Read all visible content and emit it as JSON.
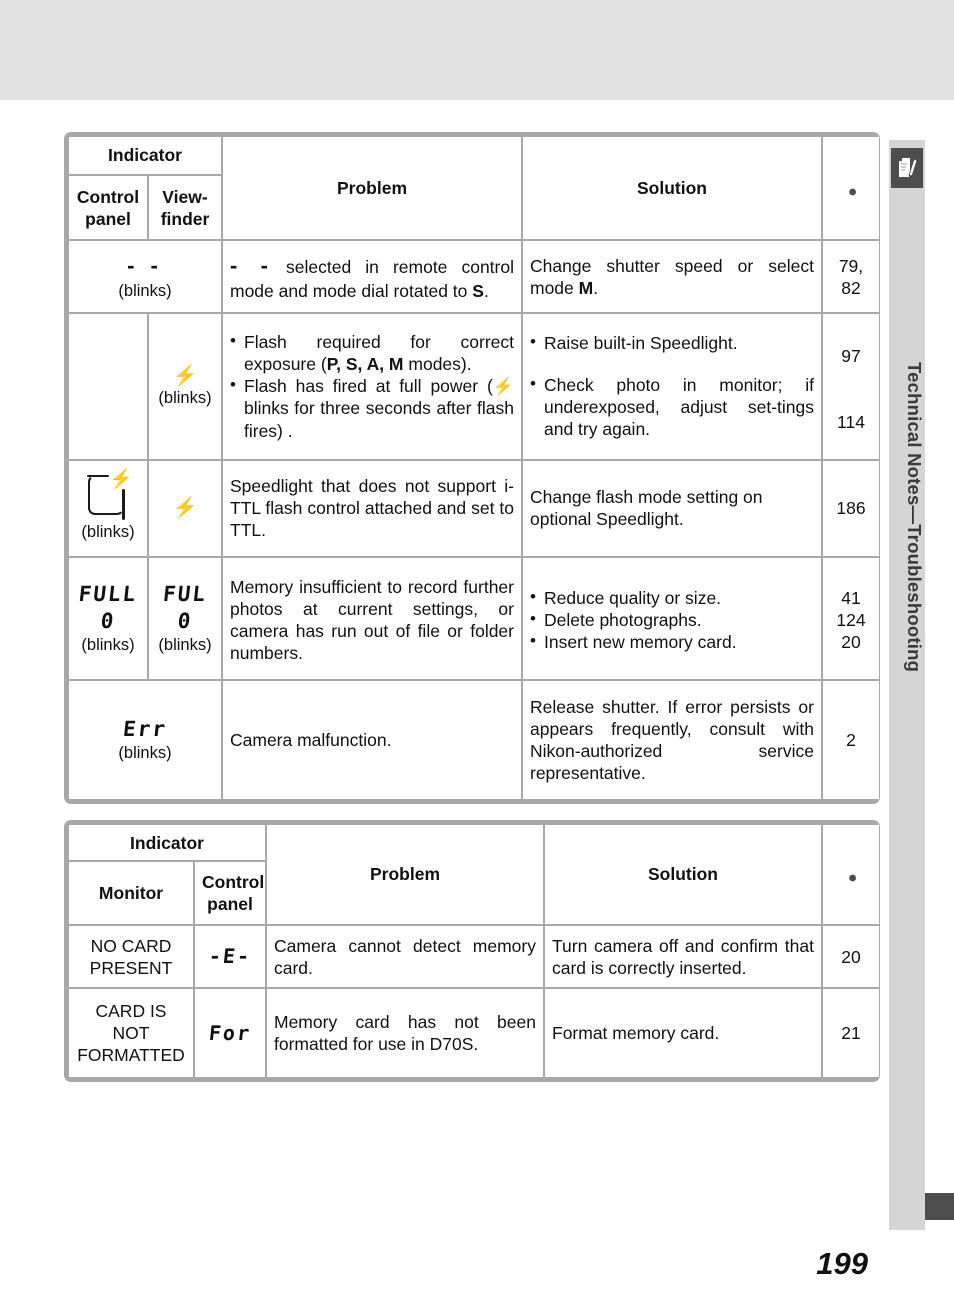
{
  "sidebar": {
    "icon": "pencil-note-icon",
    "label": "Technical Notes—Troubleshooting"
  },
  "page_number": "199",
  "colors": {
    "header_bg": "#4d4d4d",
    "table_border": "#a8a8a8",
    "shade_row": "#e9e9e9",
    "top_band": "#e2e2e2",
    "side_tab": "#d5d5d5"
  },
  "table1": {
    "headers": {
      "indicator": "Indicator",
      "control_panel": "Control\npanel",
      "control_panel_l1": "Control",
      "control_panel_l2": "panel",
      "viewfinder_l1": "View-",
      "viewfinder_l2": "finder",
      "problem": "Problem",
      "solution": "Solution",
      "page_ref_icon": "eye-reference-icon"
    },
    "rows": [
      {
        "control_panel": "- -",
        "control_panel_note": "(blinks)",
        "viewfinder": "",
        "problem": "- - selected in remote control mode and mode dial rotated to S.",
        "problem_lcd": "- -",
        "problem_rest": " selected in remote control mode and mode dial rotated to ",
        "problem_bold": "S",
        "problem_end": ".",
        "solution": "Change shutter speed or select mode M.",
        "solution_pre": "Change shutter speed or select mode ",
        "solution_bold": "M",
        "solution_end": ".",
        "pages": "79,\n82",
        "pages_l1": "79,",
        "pages_l2": "82"
      },
      {
        "control_panel": "",
        "viewfinder": "flash-bolt-icon",
        "viewfinder_note": "(blinks)",
        "problem_bullets": [
          "Flash required for correct exposure (P, S, A, M modes).",
          "Flash has fired at full power ( blinks for three seconds after flash fires) ."
        ],
        "problem_b1_pre": "Flash required for correct exposure (",
        "problem_b1_modes": "P, S, A, M",
        "problem_b1_post": " modes).",
        "problem_b2_pre": "Flash has fired at full power (",
        "problem_b2_post": " blinks for three seconds after flash fires) .",
        "solution_bullets": [
          "Raise built-in Speedlight.",
          "Check photo in monitor; if underexposed, adjust settings and try again."
        ],
        "solution_b1": "Raise built-in Speedlight.",
        "solution_b2": "Check photo in monitor; if underexposed, adjust set-tings and try again.",
        "pages_l1": "97",
        "pages_l2": "114"
      },
      {
        "control_panel": "bracket-flash-icon",
        "control_panel_note": "(blinks)",
        "viewfinder": "flash-bolt-icon",
        "problem": "Speedlight that does not support i-TTL flash control attached and set to TTL.",
        "solution": "Change flash mode setting on optional Speedlight.",
        "pages": "186"
      },
      {
        "control_panel_lcd1": "FULL",
        "control_panel_lcd2": "0",
        "control_panel_note": "(blinks)",
        "viewfinder_lcd1": "FUL",
        "viewfinder_lcd2": "0",
        "viewfinder_note": "(blinks)",
        "problem": "Memory insufficient to record further photos at current settings, or camera has run out of file or folder numbers.",
        "solution_bullets": [
          "Reduce quality or size.",
          "Delete photographs.",
          "Insert new memory card."
        ],
        "solution_b1": "Reduce quality or size.",
        "solution_b2": "Delete photographs.",
        "solution_b3": "Insert new memory card.",
        "pages_l1": "41",
        "pages_l2": "124",
        "pages_l3": "20"
      },
      {
        "control_panel_lcd1": "Err",
        "control_panel_note": "(blinks)",
        "problem": "Camera malfunction.",
        "solution": "Release shutter.  If error persists or appears frequently, consult with Nikon-authorized service representative.",
        "pages": "2"
      }
    ]
  },
  "table2": {
    "headers": {
      "indicator": "Indicator",
      "monitor": "Monitor",
      "control_panel_l1": "Control",
      "control_panel_l2": "panel",
      "problem": "Problem",
      "solution": "Solution",
      "page_ref_icon": "eye-reference-icon"
    },
    "rows": [
      {
        "monitor_l1": "NO CARD",
        "monitor_l2": "PRESENT",
        "control_panel_lcd": "-E-",
        "problem": "Camera cannot detect memory card.",
        "solution": "Turn camera off and confirm that card is correctly inserted.",
        "pages": "20"
      },
      {
        "monitor_l1": "CARD IS NOT",
        "monitor_l2": "FORMATTED",
        "control_panel_lcd": "For",
        "problem": "Memory card has not been formatted for use in D70S.",
        "solution": "Format memory card.",
        "pages": "21"
      }
    ]
  }
}
